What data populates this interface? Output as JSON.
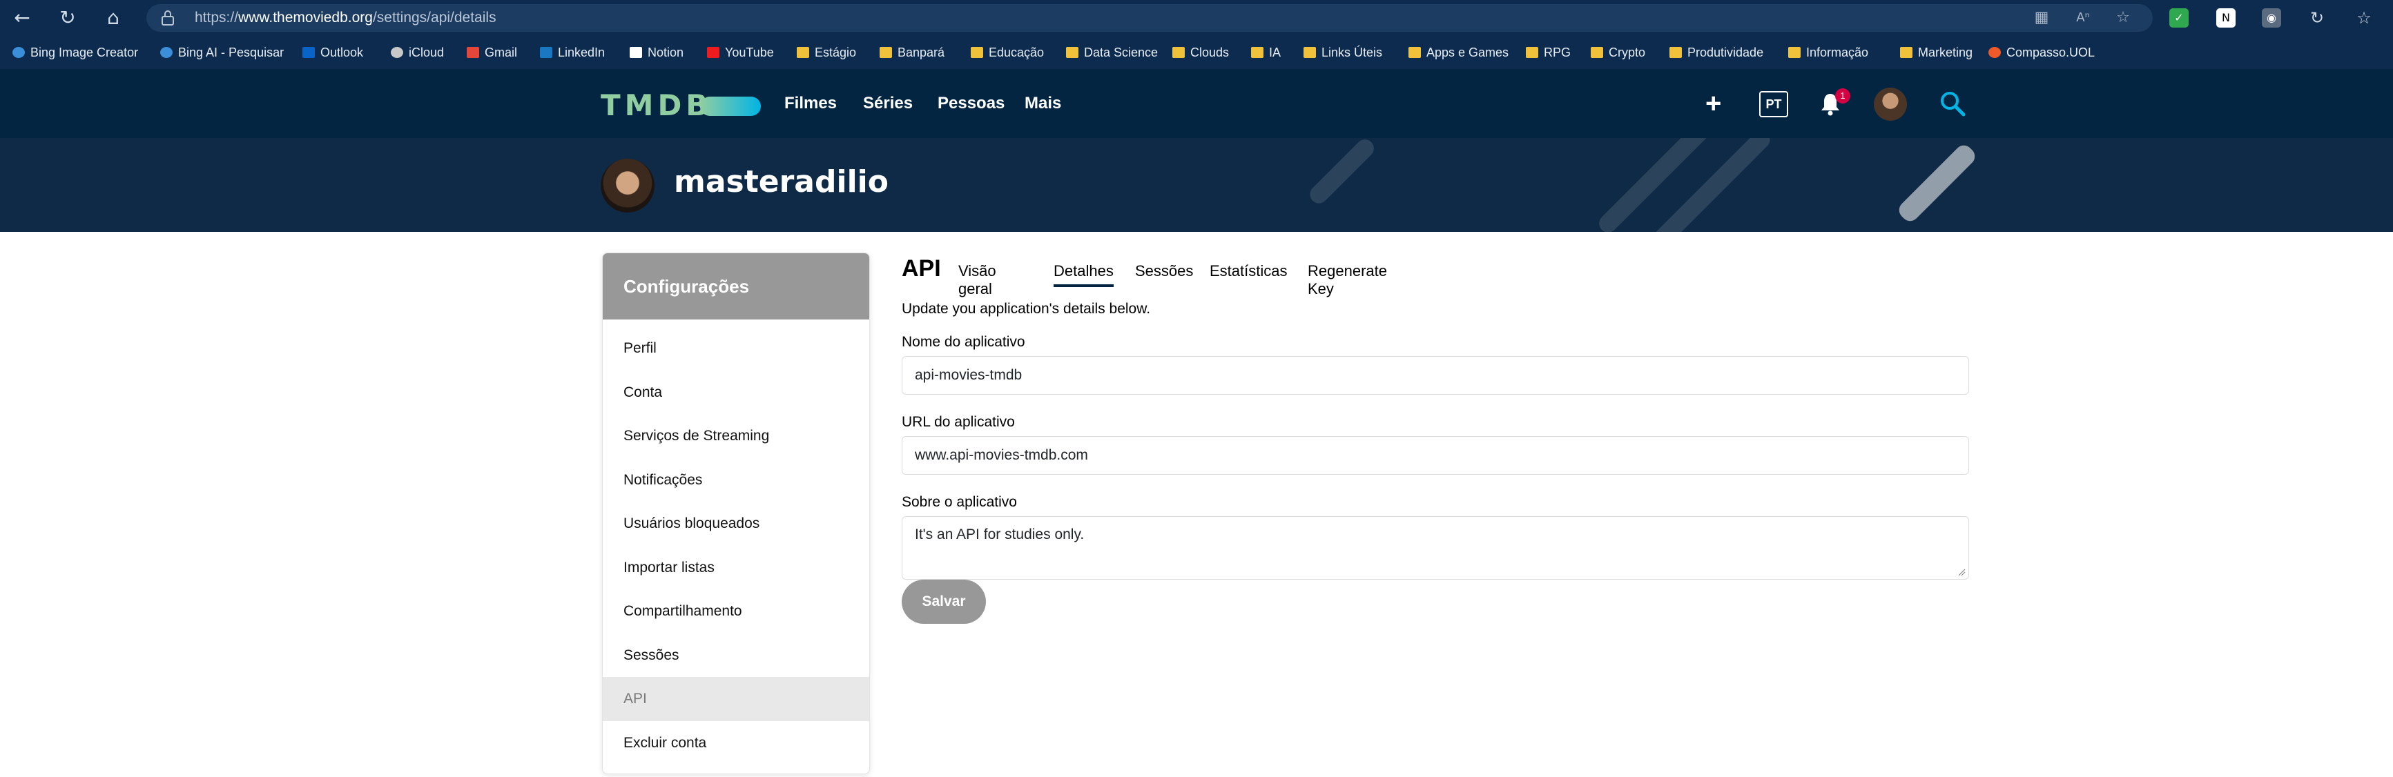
{
  "browser": {
    "url_prefix": "https://",
    "url_host": "www.themoviedb.org",
    "url_path": "/settings/api/details",
    "icons": [
      "back-icon",
      "refresh-icon",
      "home-icon",
      "lock-icon",
      "apps-icon",
      "read-aloud-icon",
      "favorite-star-icon",
      "split-screen-icon",
      "favorites-icon"
    ]
  },
  "bookmarks": [
    {
      "label": "Bing Image Creator",
      "icon": "search-icon"
    },
    {
      "label": "Bing AI - Pesquisar",
      "icon": "search-icon"
    },
    {
      "label": "Outlook",
      "icon": "outlook-icon"
    },
    {
      "label": "iCloud",
      "icon": "apple-icon"
    },
    {
      "label": "Gmail",
      "icon": "gmail-icon"
    },
    {
      "label": "LinkedIn",
      "icon": "linkedin-icon"
    },
    {
      "label": "Notion",
      "icon": "notion-icon"
    },
    {
      "label": "YouTube",
      "icon": "youtube-icon"
    },
    {
      "label": "Estágio",
      "icon": "folder-icon"
    },
    {
      "label": "Banpará",
      "icon": "folder-icon"
    },
    {
      "label": "Educação",
      "icon": "folder-icon"
    },
    {
      "label": "Data Science",
      "icon": "folder-icon"
    },
    {
      "label": "Clouds",
      "icon": "folder-icon"
    },
    {
      "label": "IA",
      "icon": "folder-icon"
    },
    {
      "label": "Links Úteis",
      "icon": "folder-icon"
    },
    {
      "label": "Apps e Games",
      "icon": "folder-icon"
    },
    {
      "label": "RPG",
      "icon": "folder-icon"
    },
    {
      "label": "Crypto",
      "icon": "folder-icon"
    },
    {
      "label": "Produtividade",
      "icon": "folder-icon"
    },
    {
      "label": "Informação",
      "icon": "folder-icon"
    },
    {
      "label": "Marketing",
      "icon": "folder-icon"
    },
    {
      "label": "Compasso.UOL",
      "icon": "compasso-icon"
    }
  ],
  "header": {
    "logo": "TMDB",
    "nav": [
      "Filmes",
      "Séries",
      "Pessoas",
      "Mais"
    ],
    "language": "PT",
    "notification_count": "1",
    "colors": {
      "background": "#032541",
      "logo_green": "#90cea1",
      "logo_blue": "#01b4e4",
      "badge": "#d40242"
    }
  },
  "profile": {
    "username": "masteradilio"
  },
  "sidebar": {
    "title": "Configurações",
    "items": [
      {
        "label": "Perfil",
        "active": false
      },
      {
        "label": "Conta",
        "active": false
      },
      {
        "label": "Serviços de Streaming",
        "active": false
      },
      {
        "label": "Notificações",
        "active": false
      },
      {
        "label": "Usuários bloqueados",
        "active": false
      },
      {
        "label": "Importar listas",
        "active": false
      },
      {
        "label": "Compartilhamento",
        "active": false
      },
      {
        "label": "Sessões",
        "active": false
      },
      {
        "label": "API",
        "active": true
      },
      {
        "label": "Excluir conta",
        "active": false
      }
    ]
  },
  "api": {
    "title": "API",
    "tabs": [
      {
        "label": "Visão geral",
        "active": false
      },
      {
        "label": "Detalhes",
        "active": true
      },
      {
        "label": "Sessões",
        "active": false
      },
      {
        "label": "Estatísticas",
        "active": false
      },
      {
        "label": "Regenerate Key",
        "active": false
      }
    ],
    "intro": "Update you application's details below.",
    "fields": {
      "name_label": "Nome do aplicativo",
      "name_value": "api-movies-tmdb",
      "url_label": "URL do aplicativo",
      "url_value": "www.api-movies-tmdb.com",
      "about_label": "Sobre o aplicativo",
      "about_value": "It's an API for studies only."
    },
    "save_label": "Salvar"
  }
}
